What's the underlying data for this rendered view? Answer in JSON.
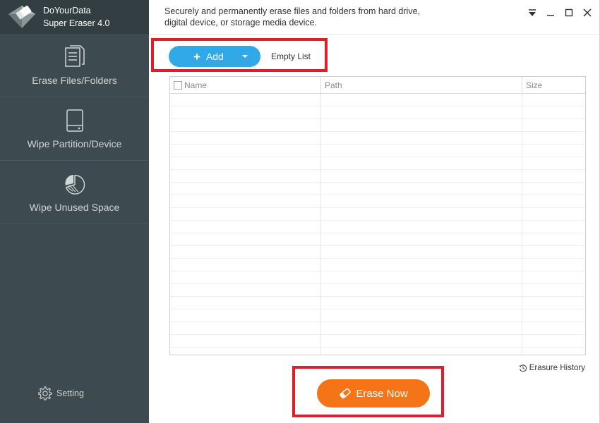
{
  "app": {
    "name_line1": "DoYourData",
    "name_line2": "Super Eraser 4.0",
    "description_line1": "Securely and permanently erase files and folders from hard drive,",
    "description_line2": "digital device, or storage media device."
  },
  "sidebar": {
    "items": [
      {
        "label": "Erase Files/Folders",
        "icon": "files-icon"
      },
      {
        "label": "Wipe Partition/Device",
        "icon": "drive-icon"
      },
      {
        "label": "Wipe Unused Space",
        "icon": "pie-icon"
      }
    ],
    "setting_label": "Setting"
  },
  "window_controls": [
    "menu-icon",
    "minimize-icon",
    "maximize-icon",
    "close-icon"
  ],
  "toolbar": {
    "add_label": "Add",
    "empty_list_label": "Empty List"
  },
  "table": {
    "columns": [
      "Name",
      "Path",
      "Size"
    ],
    "rows": []
  },
  "footer": {
    "history_label": "Erasure History",
    "erase_label": "Erase Now"
  },
  "colors": {
    "sidebar_bg": "#3d4a4f",
    "accent_blue": "#30a9e6",
    "accent_orange": "#f57418",
    "highlight_red": "#dd1f2c"
  }
}
